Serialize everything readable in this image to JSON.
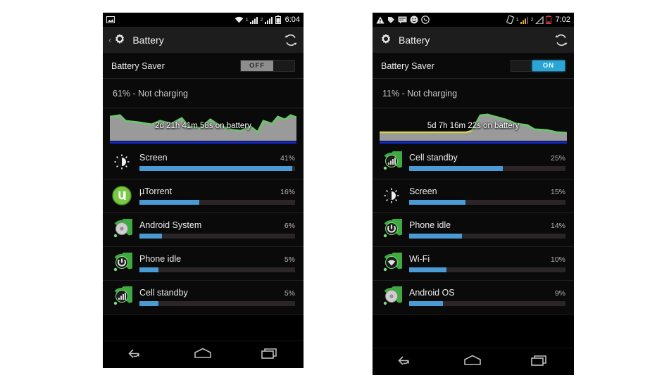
{
  "phones": [
    {
      "id": "left",
      "statusbar": {
        "time": "6:04",
        "notif_icons": [
          "image-icon"
        ],
        "sim1_label": "1",
        "sim2_label": "2",
        "right_icons": [
          "wifi-icon",
          "signal-icon",
          "signal-icon",
          "battery-icon"
        ]
      },
      "actionbar": {
        "back_label": "‹",
        "title": "Battery",
        "icon": "gear-icon",
        "refresh_icon": "refresh-icon"
      },
      "battery_saver": {
        "label": "Battery Saver",
        "state": "OFF",
        "on": false
      },
      "status_text": "61% - Not charging",
      "graph_label": "2d 21h 41m 58s on battery",
      "items": [
        {
          "name": "Screen",
          "pct": "41%",
          "value": 41,
          "icon": "brightness-icon"
        },
        {
          "name": "µTorrent",
          "pct": "16%",
          "value": 16,
          "icon": "utorrent-icon"
        },
        {
          "name": "Android System",
          "pct": "6%",
          "value": 6,
          "icon": "android-icon"
        },
        {
          "name": "Phone idle",
          "pct": "5%",
          "value": 5,
          "icon": "power-icon"
        },
        {
          "name": "Cell standby",
          "pct": "5%",
          "value": 5,
          "icon": "signal-bars-icon"
        }
      ],
      "navbar": [
        "back-icon",
        "home-icon",
        "recents-icon"
      ]
    },
    {
      "id": "right",
      "statusbar": {
        "time": "7:02",
        "notif_icons": [
          "warning-icon",
          "tag-icon",
          "message-icon",
          "emoji-icon",
          "whatsapp-icon"
        ],
        "sim1_label": "1",
        "sim2_label": "2",
        "right_icons": [
          "rotate-icon",
          "signal-icon",
          "signal-icon",
          "battery-low-icon"
        ]
      },
      "actionbar": {
        "back_label": "",
        "title": "Battery",
        "icon": "gear-icon",
        "refresh_icon": "refresh-icon"
      },
      "battery_saver": {
        "label": "Battery Saver",
        "state": "ON",
        "on": true
      },
      "status_text": "11% - Not charging",
      "graph_label": "5d 7h 16m 22s on battery",
      "items": [
        {
          "name": "Cell standby",
          "pct": "25%",
          "value": 25,
          "icon": "signal-bars-icon"
        },
        {
          "name": "Screen",
          "pct": "15%",
          "value": 15,
          "icon": "brightness-icon"
        },
        {
          "name": "Phone idle",
          "pct": "14%",
          "value": 14,
          "icon": "power-icon"
        },
        {
          "name": "Wi-Fi",
          "pct": "10%",
          "value": 10,
          "icon": "wifi-circle-icon"
        },
        {
          "name": "Android OS",
          "pct": "9%",
          "value": 9,
          "icon": "android-icon"
        }
      ],
      "navbar": [
        "back-icon",
        "home-icon",
        "recents-icon"
      ]
    }
  ],
  "colors": {
    "accent_blue": "#4a9bd4",
    "toggle_on": "#2aa6d6",
    "graph_green": "#6ec46e",
    "graph_gray": "#9a9a9a",
    "graph_bar_blue": "#1428d2",
    "graph_yellow": "#d6d14a",
    "background": "#0a0a0a"
  }
}
